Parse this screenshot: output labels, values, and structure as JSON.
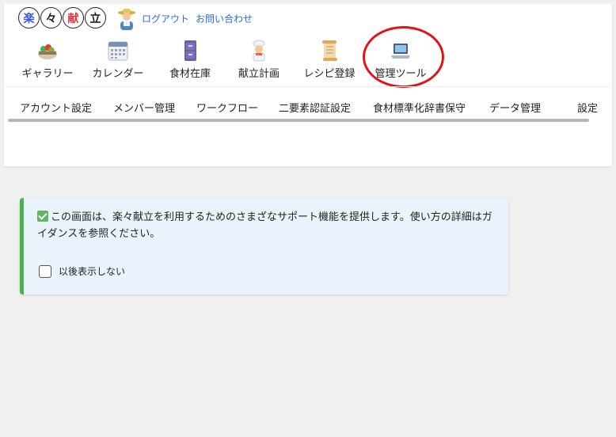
{
  "logo": {
    "chars": [
      "楽",
      "々",
      "献",
      "立"
    ]
  },
  "top_links": {
    "logout": "ログアウト",
    "contact": "お問い合わせ"
  },
  "nav": [
    {
      "label": "ギャラリー",
      "icon": "salad-bowl-icon"
    },
    {
      "label": "カレンダー",
      "icon": "calendar-icon"
    },
    {
      "label": "食材在庫",
      "icon": "filing-cabinet-icon"
    },
    {
      "label": "献立計画",
      "icon": "chef-icon"
    },
    {
      "label": "レシピ登録",
      "icon": "scroll-icon"
    },
    {
      "label": "管理ツール",
      "icon": "laptop-icon"
    }
  ],
  "subtabs": [
    "アカウント設定",
    "メンバー管理",
    "ワークフロー",
    "二要素認証設定",
    "食材標準化辞書保守",
    "データ管理",
    "設定"
  ],
  "notice": {
    "message": "この画面は、楽々献立を利用するためのさまざなサポート機能を提供します。使い方の詳細はガイダンスを参照ください。",
    "dont_show_label": "以後表示しない"
  },
  "colors": {
    "accent_link": "#2a6fd6",
    "notice_border": "#4caf50",
    "highlight": "#e0141a"
  }
}
